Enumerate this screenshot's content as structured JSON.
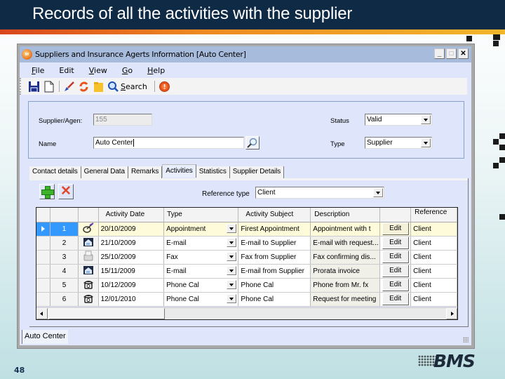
{
  "slide": {
    "title": "Records of all the activities with the supplier",
    "page_number": "48",
    "logo_text": "BMS"
  },
  "window": {
    "title": "Suppliers and Insurance Agerts Information [Auto Center]",
    "controls": {
      "minimize": "_",
      "maximize": "□",
      "close": "✕"
    },
    "menu": [
      {
        "label": "File",
        "accel": "F",
        "rest": "ile"
      },
      {
        "label": "Edit",
        "accel": "",
        "rest": "Edit"
      },
      {
        "label": "View",
        "accel": "V",
        "rest": "iew"
      },
      {
        "label": "Go",
        "accel": "G",
        "rest": "o"
      },
      {
        "label": "Help",
        "accel": "H",
        "rest": "elp"
      }
    ],
    "toolbar": {
      "search_accel": "S",
      "search_rest": "earch",
      "icons": [
        "save-icon",
        "new-document-icon",
        "clear-brush-icon",
        "refresh-icon",
        "folder-icon",
        "search-icon",
        "exit-icon"
      ]
    },
    "statusbar": "Auto Center"
  },
  "form": {
    "supplier_label": "Supplier/Agen:",
    "supplier_value": "155",
    "name_label": "Name",
    "name_value": "Auto Center",
    "status_label": "Status",
    "status_value": "Valid",
    "type_label": "Type",
    "type_value": "Supplier"
  },
  "tabs": [
    {
      "label": "Contact details",
      "active": false
    },
    {
      "label": "General Data",
      "active": false
    },
    {
      "label": "Remarks",
      "active": false
    },
    {
      "label": "Activities",
      "active": true
    },
    {
      "label": "Statistics",
      "active": false
    },
    {
      "label": "Supplier Details",
      "active": false
    }
  ],
  "activities": {
    "reference_type_label": "Reference type",
    "reference_type_value": "Client",
    "columns": [
      "",
      "",
      "Activity Date",
      "Type",
      "Activity Subject",
      "Description",
      "",
      "Reference"
    ],
    "edit_label": "Edit",
    "rows": [
      {
        "num": "1",
        "icon": "appointment-icon",
        "date": "20/10/2009",
        "type": "Appointment",
        "subject": "Firest Appointment",
        "description": "Appointment with t",
        "reference": "Client",
        "selected": true
      },
      {
        "num": "2",
        "icon": "email-icon",
        "date": "21/10/2009",
        "type": "E-mail",
        "subject": "E-mail to Supplier",
        "description": "E-mail with request...",
        "reference": "Client",
        "selected": false
      },
      {
        "num": "3",
        "icon": "fax-icon",
        "date": "25/10/2009",
        "type": "Fax",
        "subject": "Fax from Supplier",
        "description": "Fax confirming dis...",
        "reference": "Client",
        "selected": false
      },
      {
        "num": "4",
        "icon": "email-icon",
        "date": "15/11/2009",
        "type": "E-mail",
        "subject": "E-mail from Supplier",
        "description": "Prorata invoice",
        "reference": "Client",
        "selected": false
      },
      {
        "num": "5",
        "icon": "phone-icon",
        "date": "10/12/2009",
        "type": "Phone Cal",
        "subject": "Phone Cal",
        "description": "Phone from Mr. fx",
        "reference": "Client",
        "selected": false
      },
      {
        "num": "6",
        "icon": "phone-icon",
        "date": "12/01/2010",
        "type": "Phone Cal",
        "subject": "Phone Cal",
        "description": "Request for meeting",
        "reference": "Client",
        "selected": false
      }
    ]
  }
}
